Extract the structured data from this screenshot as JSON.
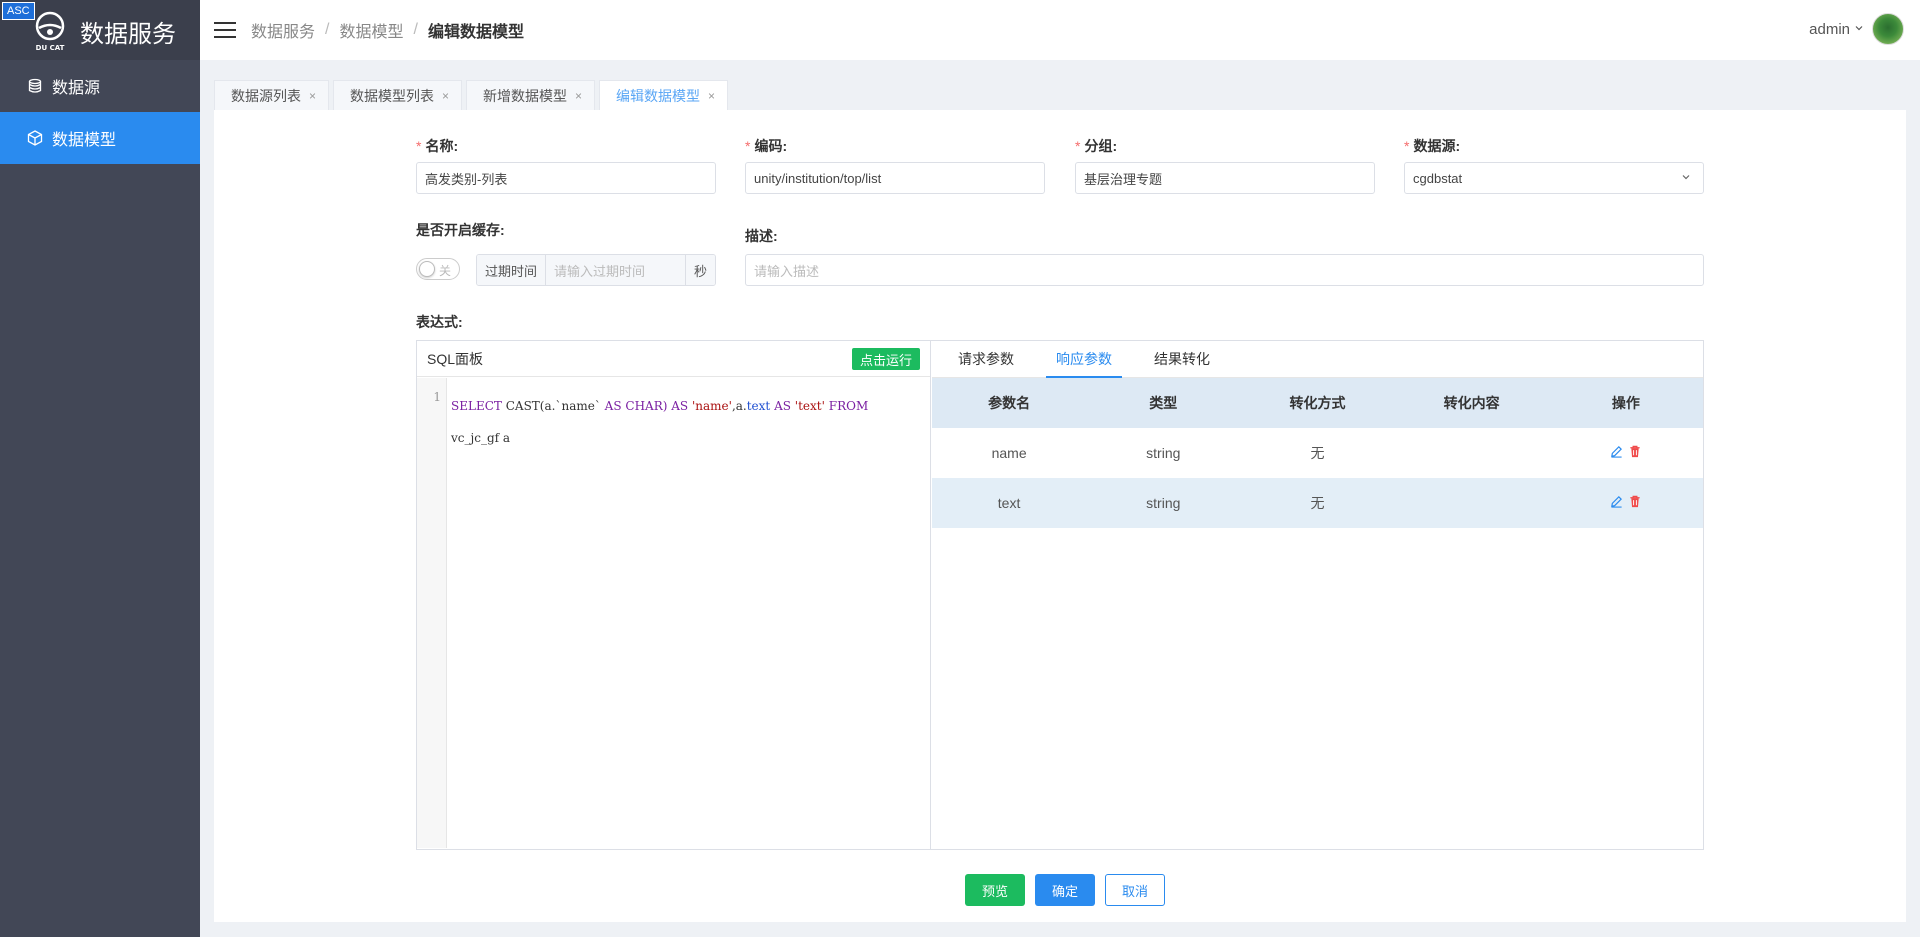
{
  "app": {
    "badge": "ASC",
    "logo_caption": "DU CAT",
    "title": "数据服务"
  },
  "sidebar": {
    "items": [
      {
        "label": "数据源",
        "icon": "database-icon",
        "active": false
      },
      {
        "label": "数据模型",
        "icon": "cube-icon",
        "active": true
      }
    ]
  },
  "header": {
    "breadcrumb": [
      "数据服务",
      "数据模型",
      "编辑数据模型"
    ],
    "user": "admin"
  },
  "tabs": [
    {
      "label": "数据源列表",
      "close": "×"
    },
    {
      "label": "数据模型列表",
      "close": "×"
    },
    {
      "label": "新增数据模型",
      "close": "×"
    },
    {
      "label": "编辑数据模型",
      "close": "×"
    }
  ],
  "form": {
    "name": {
      "label": "名称:",
      "value": "高发类别-列表"
    },
    "code": {
      "label": "编码:",
      "value": "unity/institution/top/list"
    },
    "group": {
      "label": "分组:",
      "value": "基层治理专题"
    },
    "datasource": {
      "label": "数据源:",
      "value": "cgdbstat"
    },
    "cache": {
      "label": "是否开启缓存:",
      "switch_text": "关",
      "expire_label": "过期时间",
      "expire_placeholder": "请输入过期时间",
      "unit": "秒"
    },
    "desc": {
      "label": "描述:",
      "placeholder": "请输入描述"
    },
    "required_mark": "*"
  },
  "expression": {
    "label": "表达式:",
    "sql_title": "SQL面板",
    "run_button": "点击运行",
    "line_number": "1",
    "code": {
      "select": "SELECT",
      "cast": "CAST(a.",
      "name_field": "`name`",
      "as1": "AS",
      "char": "CHAR)",
      "as2": "AS",
      "name_alias": "'name'",
      "comma": ",a.",
      "text_field": "text",
      "as3": "AS",
      "text_alias": "'text'",
      "from": "FROM",
      "table": "vc_jc_gf a"
    }
  },
  "params": {
    "tabs": [
      "请求参数",
      "响应参数",
      "结果转化"
    ],
    "active_tab": 1,
    "columns": [
      "参数名",
      "类型",
      "转化方式",
      "转化内容",
      "操作"
    ],
    "rows": [
      {
        "name": "name",
        "type": "string",
        "mode": "无",
        "content": ""
      },
      {
        "name": "text",
        "type": "string",
        "mode": "无",
        "content": ""
      }
    ]
  },
  "footer": {
    "preview": "预览",
    "confirm": "确定",
    "cancel": "取消"
  },
  "colors": {
    "sidebar_bg": "#424756",
    "active_blue": "#2a8bef",
    "green": "#1cbb5f",
    "required": "#f56c6c"
  }
}
